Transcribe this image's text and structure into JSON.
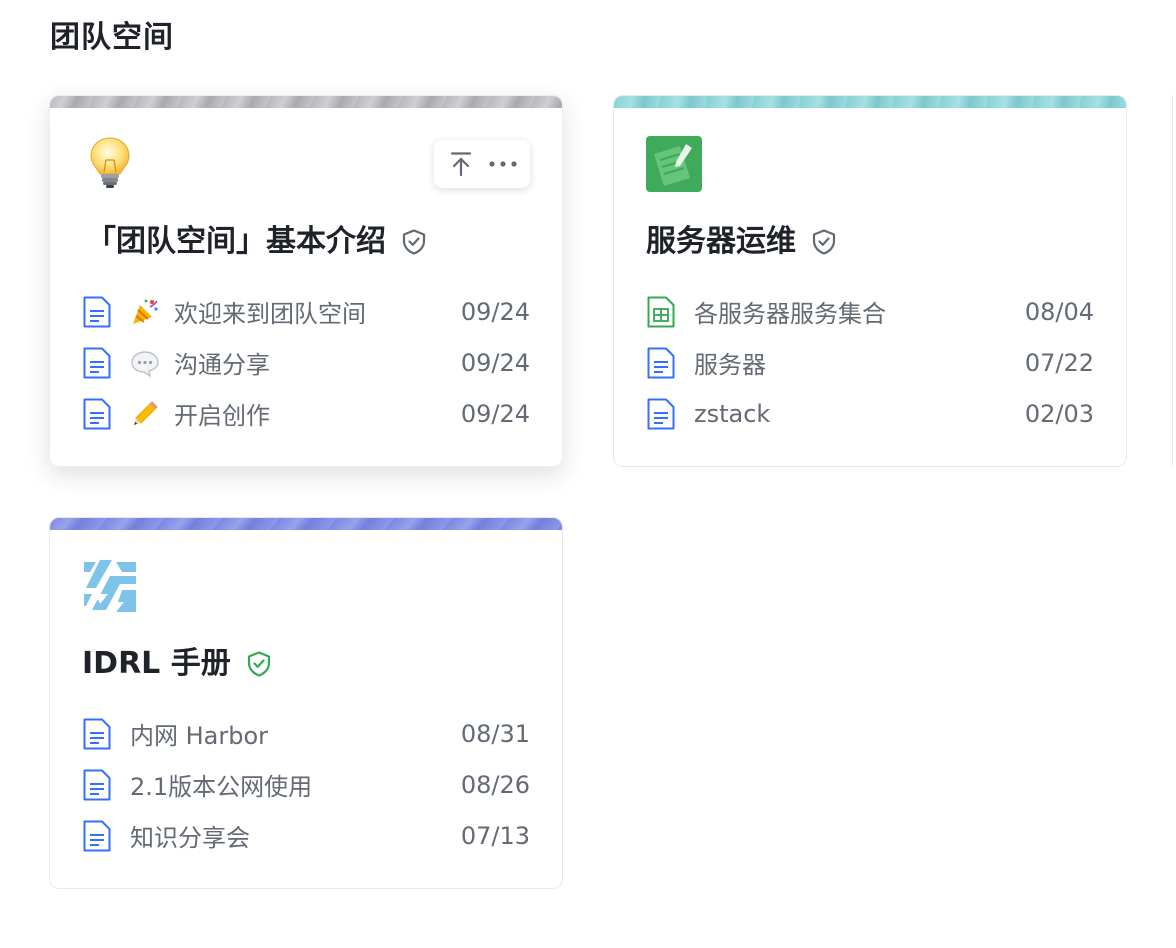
{
  "page": {
    "title": "团队空间"
  },
  "colors": {
    "title_text": "#1f2329",
    "secondary_text": "#646a73",
    "doc_icon_blue": "#3370ff",
    "sheet_icon_green": "#34a853",
    "shield_gray": "#646a73",
    "shield_green": "#34a853"
  },
  "spaces": [
    {
      "title": "「团队空间」基本介绍",
      "icon": "lightbulb-icon",
      "shield": "shield-check-gray-icon",
      "toolbar": {
        "pin_icon": "pin-to-top-icon",
        "more_icon": "more-dots-icon"
      },
      "docs": [
        {
          "emoji": "party-popper-icon",
          "name": "欢迎来到团队空间",
          "date": "09/24",
          "type": "doc-icon"
        },
        {
          "emoji": "speech-bubble-icon",
          "name": "沟通分享",
          "date": "09/24",
          "type": "doc-icon"
        },
        {
          "emoji": "pencil-icon",
          "name": "开启创作",
          "date": "09/24",
          "type": "doc-icon"
        }
      ]
    },
    {
      "title": "服务器运维",
      "icon": "notepad-pen-icon",
      "shield": "shield-check-gray-icon",
      "docs": [
        {
          "name": "各服务器服务集合",
          "date": "08/04",
          "type": "sheet-icon"
        },
        {
          "name": "服务器",
          "date": "07/22",
          "type": "doc-icon"
        },
        {
          "name": "zstack",
          "date": "02/03",
          "type": "doc-icon"
        }
      ]
    },
    {
      "title": "IDRL 手册",
      "icon": "idrl-logo-icon",
      "shield": "shield-check-green-icon",
      "docs": [
        {
          "name": "内网 Harbor",
          "date": "08/31",
          "type": "doc-icon"
        },
        {
          "name": "2.1版本公网使用",
          "date": "08/26",
          "type": "doc-icon"
        },
        {
          "name": "知识分享会",
          "date": "07/13",
          "type": "doc-icon"
        }
      ]
    }
  ]
}
